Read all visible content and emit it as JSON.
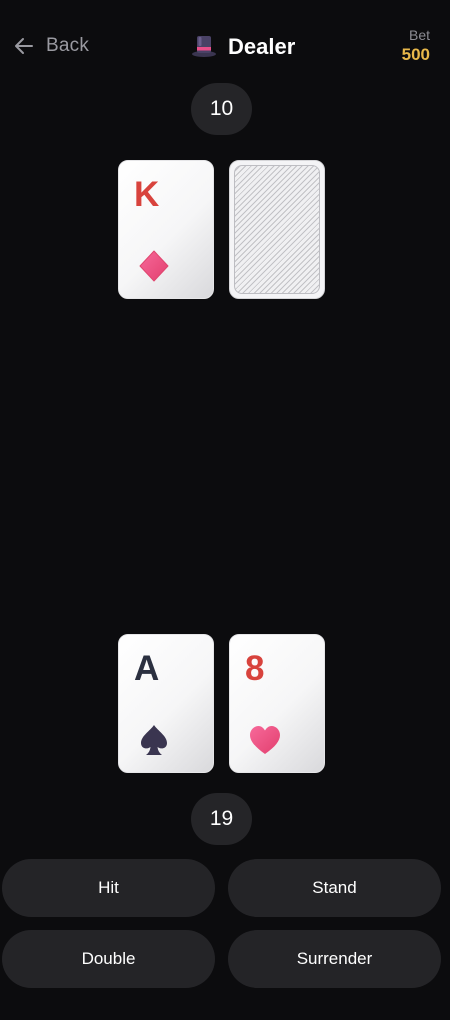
{
  "header": {
    "back_label": "Back",
    "title": "Dealer",
    "bet_label": "Bet",
    "bet_value": "500"
  },
  "dealer": {
    "score": "10",
    "cards": [
      {
        "rank": "K",
        "suit": "diamond",
        "color": "#d8433d"
      },
      {
        "face_down": true
      }
    ]
  },
  "player": {
    "score": "19",
    "cards": [
      {
        "rank": "A",
        "suit": "spade",
        "color": "#2b3040"
      },
      {
        "rank": "8",
        "suit": "heart",
        "color": "#d8433d"
      }
    ]
  },
  "actions": {
    "hit": "Hit",
    "stand": "Stand",
    "double": "Double",
    "surrender": "Surrender"
  },
  "icons": {
    "back": "arrow-left-icon",
    "dealer": "top-hat-icon"
  },
  "colors": {
    "background": "#0c0c0e",
    "bet_value": "#e8b84a",
    "pill": "#252528",
    "button": "#242427",
    "suit_red": "#d8433d",
    "suit_pink": "#ee4a78"
  }
}
